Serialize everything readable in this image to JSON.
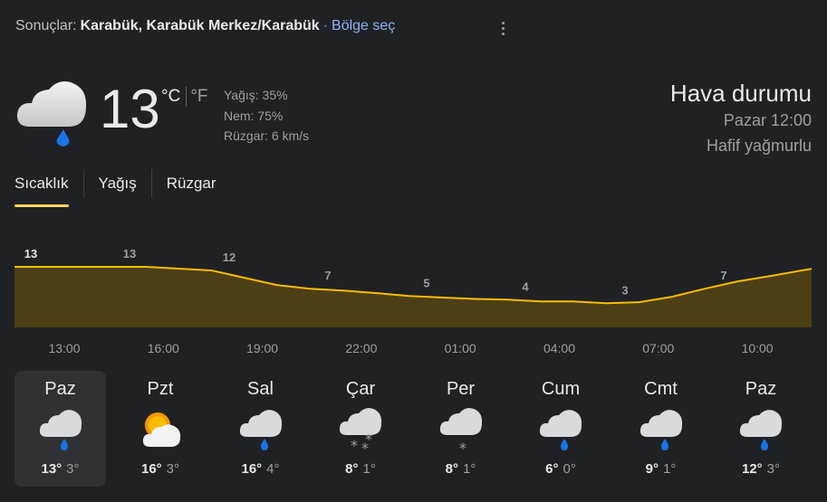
{
  "header": {
    "prefix": "Sonuçlar:",
    "location": "Karabük, Karabük Merkez/Karabük",
    "separator": "·",
    "region_link": "Bölge seç"
  },
  "current": {
    "icon": "rain-cloud-icon",
    "temperature": "13",
    "unit_c": "°C",
    "unit_f": "°F",
    "precip": "Yağış: 35%",
    "humidity": "Nem: 75%",
    "wind": "Rüzgar: 6 km/s"
  },
  "summary": {
    "title": "Hava durumu",
    "time": "Pazar 12:00",
    "condition": "Hafif yağmurlu"
  },
  "tabs": [
    {
      "label": "Sıcaklık"
    },
    {
      "label": "Yağış"
    },
    {
      "label": "Rüzgar"
    }
  ],
  "chart_data": {
    "type": "area",
    "x": [
      "13:00",
      "14:00",
      "15:00",
      "16:00",
      "17:00",
      "18:00",
      "19:00",
      "20:00",
      "21:00",
      "22:00",
      "23:00",
      "00:00",
      "01:00",
      "02:00",
      "03:00",
      "04:00",
      "05:00",
      "06:00",
      "07:00",
      "08:00",
      "09:00",
      "10:00",
      "11:00",
      "12:00"
    ],
    "values": [
      13,
      13,
      13,
      13,
      13,
      12.5,
      12,
      10,
      8,
      7,
      6.5,
      5.8,
      5,
      4.6,
      4.2,
      4,
      3.5,
      3.5,
      3,
      3.3,
      4.8,
      7,
      9,
      10.5
    ],
    "labels": [
      {
        "x_index": 0,
        "text": "13"
      },
      {
        "x_index": 3,
        "text": "13"
      },
      {
        "x_index": 6,
        "text": "12"
      },
      {
        "x_index": 9,
        "text": "7"
      },
      {
        "x_index": 12,
        "text": "5"
      },
      {
        "x_index": 15,
        "text": "4"
      },
      {
        "x_index": 18,
        "text": "3"
      },
      {
        "x_index": 21,
        "text": "7"
      }
    ],
    "tick_labels": [
      "13:00",
      "16:00",
      "19:00",
      "22:00",
      "01:00",
      "04:00",
      "07:00",
      "10:00"
    ],
    "line_color": "#fbbc04",
    "fill_color": "#4c3f15"
  },
  "days": [
    {
      "name": "Paz",
      "hi": "13°",
      "lo": "3°",
      "icon": "rain",
      "selected": true
    },
    {
      "name": "Pzt",
      "hi": "16°",
      "lo": "3°",
      "icon": "partly-sunny"
    },
    {
      "name": "Sal",
      "hi": "16°",
      "lo": "4°",
      "icon": "rain"
    },
    {
      "name": "Çar",
      "hi": "8°",
      "lo": "1°",
      "icon": "snow"
    },
    {
      "name": "Per",
      "hi": "8°",
      "lo": "1°",
      "icon": "light-snow"
    },
    {
      "name": "Cum",
      "hi": "6°",
      "lo": "0°",
      "icon": "rain"
    },
    {
      "name": "Cmt",
      "hi": "9°",
      "lo": "1°",
      "icon": "rain"
    },
    {
      "name": "Paz",
      "hi": "12°",
      "lo": "3°",
      "icon": "rain"
    }
  ]
}
